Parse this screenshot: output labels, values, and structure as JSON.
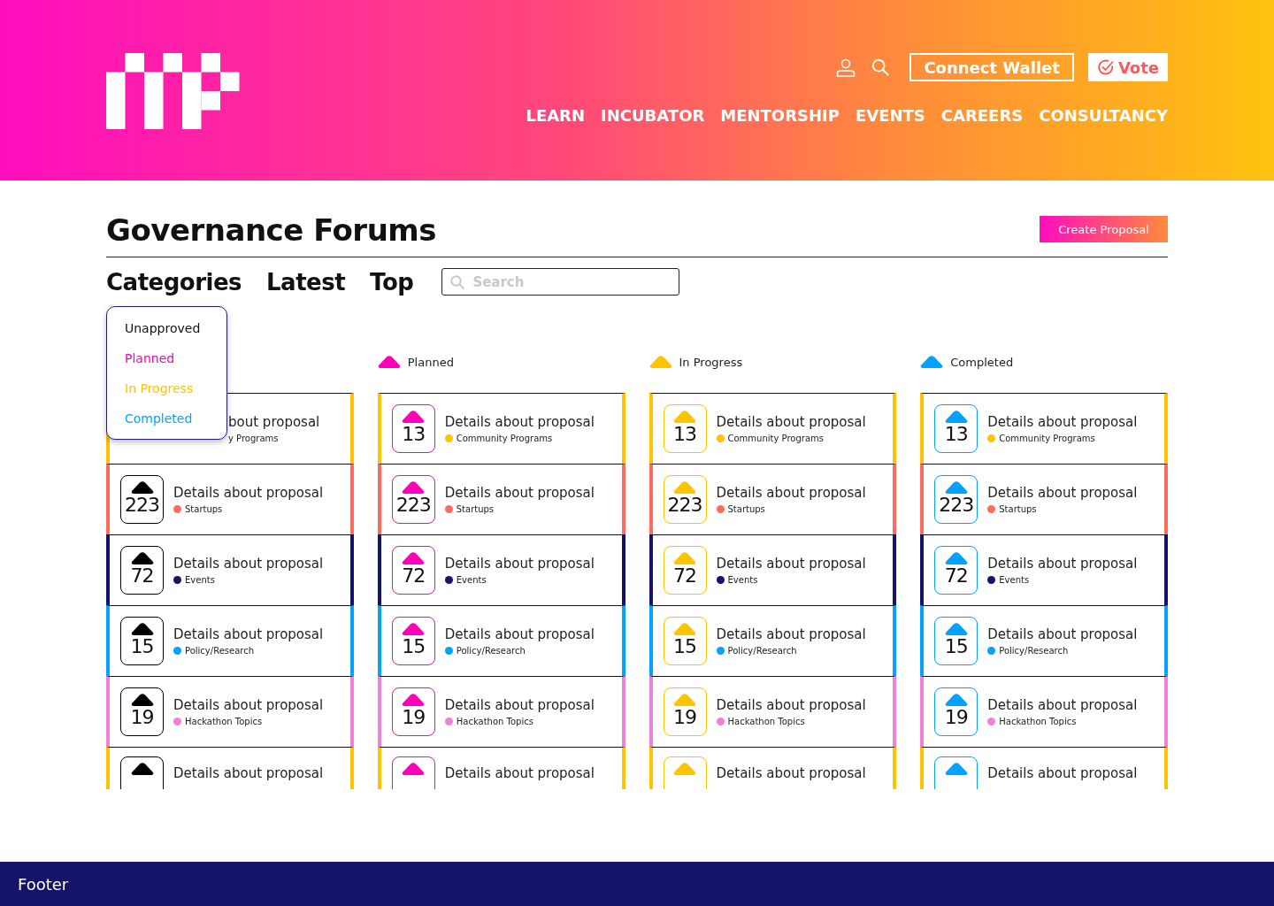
{
  "header": {
    "actions": {
      "connect": "Connect Wallet",
      "vote": "Vote"
    },
    "nav": [
      {
        "label": "LEARN"
      },
      {
        "label": "INCUBATOR"
      },
      {
        "label": "MENTORSHIP"
      },
      {
        "label": "EVENTS"
      },
      {
        "label": "CAREERS"
      },
      {
        "label": "CONSULTANCY"
      }
    ]
  },
  "title": "Governance Forums",
  "create_button": "Create Proposal",
  "tabs": [
    {
      "label": "Categories"
    },
    {
      "label": "Latest"
    },
    {
      "label": "Top"
    }
  ],
  "search": {
    "placeholder": "Search"
  },
  "dropdown": [
    {
      "label": "Unapproved",
      "color": "#111111"
    },
    {
      "label": "Planned",
      "color": "#ff00b8"
    },
    {
      "label": "In Progress",
      "color": "#ffc300"
    },
    {
      "label": "Completed",
      "color": "#00a3ff"
    }
  ],
  "columns": [
    {
      "color": "#000000",
      "cards": [
        {
          "kind": "covered",
          "title": "bout proposal",
          "category": "y Programs",
          "color": "#ffc300"
        },
        {
          "kind": "full",
          "count": "223",
          "title": "Details about proposal",
          "category": "Startups",
          "color": "#ff6b5e"
        },
        {
          "kind": "full",
          "count": "72",
          "title": "Details about proposal",
          "category": "Events",
          "color": "#14146b"
        },
        {
          "kind": "full",
          "count": "15",
          "title": "Details about proposal",
          "category": "Policy/Research",
          "color": "#00a3ff"
        },
        {
          "kind": "full",
          "count": "19",
          "title": "Details about proposal",
          "category": "Hackathon Topics",
          "color": "#f080d8"
        },
        {
          "kind": "cut",
          "title": "Details about proposal",
          "color": "#ffc300"
        }
      ]
    },
    {
      "label": "Planned",
      "color": "#ff00b8",
      "cards": [
        {
          "kind": "full",
          "count": "13",
          "title": "Details about proposal",
          "category": "Community Programs",
          "color": "#ffc300"
        },
        {
          "kind": "full",
          "count": "223",
          "title": "Details about proposal",
          "category": "Startups",
          "color": "#ff6b5e"
        },
        {
          "kind": "full",
          "count": "72",
          "title": "Details about proposal",
          "category": "Events",
          "color": "#14146b"
        },
        {
          "kind": "full",
          "count": "15",
          "title": "Details about proposal",
          "category": "Policy/Research",
          "color": "#00a3ff"
        },
        {
          "kind": "full",
          "count": "19",
          "title": "Details about proposal",
          "category": "Hackathon Topics",
          "color": "#f080d8"
        },
        {
          "kind": "cut",
          "title": "Details about proposal",
          "color": "#ffc300"
        }
      ]
    },
    {
      "label": "In Progress",
      "color": "#ffc300",
      "cards": [
        {
          "kind": "full",
          "count": "13",
          "title": "Details about proposal",
          "category": "Community Programs",
          "color": "#ffc300"
        },
        {
          "kind": "full",
          "count": "223",
          "title": "Details about proposal",
          "category": "Startups",
          "color": "#ff6b5e"
        },
        {
          "kind": "full",
          "count": "72",
          "title": "Details about proposal",
          "category": "Events",
          "color": "#14146b"
        },
        {
          "kind": "full",
          "count": "15",
          "title": "Details about proposal",
          "category": "Policy/Research",
          "color": "#00a3ff"
        },
        {
          "kind": "full",
          "count": "19",
          "title": "Details about proposal",
          "category": "Hackathon Topics",
          "color": "#f080d8"
        },
        {
          "kind": "cut",
          "title": "Details about proposal",
          "color": "#ffc300"
        }
      ]
    },
    {
      "label": "Completed",
      "color": "#00a3ff",
      "cards": [
        {
          "kind": "full",
          "count": "13",
          "title": "Details about proposal",
          "category": "Community Programs",
          "color": "#ffc300"
        },
        {
          "kind": "full",
          "count": "223",
          "title": "Details about proposal",
          "category": "Startups",
          "color": "#ff6b5e"
        },
        {
          "kind": "full",
          "count": "72",
          "title": "Details about proposal",
          "category": "Events",
          "color": "#14146b"
        },
        {
          "kind": "full",
          "count": "15",
          "title": "Details about proposal",
          "category": "Policy/Research",
          "color": "#00a3ff"
        },
        {
          "kind": "full",
          "count": "19",
          "title": "Details about proposal",
          "category": "Hackathon Topics",
          "color": "#f080d8"
        },
        {
          "kind": "cut",
          "title": "Details about proposal",
          "color": "#ffc300"
        }
      ]
    }
  ],
  "footer": "Footer"
}
